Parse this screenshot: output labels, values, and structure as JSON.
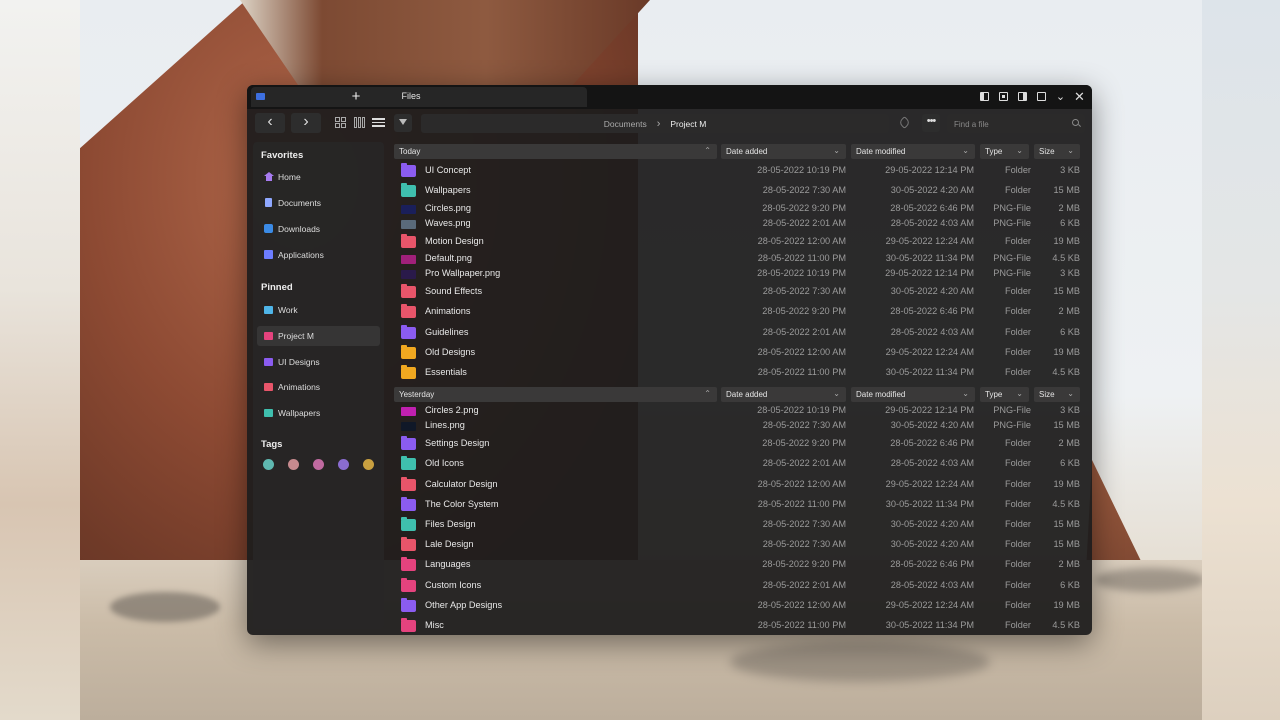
{
  "window": {
    "title": "Files",
    "new_tab": "+"
  },
  "titlebar_buttons": [
    "panel-left-icon",
    "panel-center-icon",
    "panel-right-icon",
    "restore-icon",
    "chevron-down-icon",
    "close-icon"
  ],
  "toolbar": {
    "back": "‹",
    "forward": "›",
    "breadcrumb": [
      "Documents",
      "Project M"
    ],
    "more": "•••",
    "search_placeholder": "Find a file"
  },
  "sidebar": {
    "favorites_heading": "Favorites",
    "favorites": [
      {
        "label": "Home",
        "icon": "home-icon"
      },
      {
        "label": "Documents",
        "icon": "document-icon"
      },
      {
        "label": "Downloads",
        "icon": "download-icon"
      },
      {
        "label": "Applications",
        "icon": "applications-icon"
      }
    ],
    "pinned_heading": "Pinned",
    "pinned": [
      {
        "label": "Work",
        "color": "#4fb5e8"
      },
      {
        "label": "Project M",
        "color": "#e5437e",
        "active": true
      },
      {
        "label": "UI Designs",
        "color": "#8b5cf0"
      },
      {
        "label": "Animations",
        "color": "#e8556a"
      },
      {
        "label": "Wallpapers",
        "color": "#3fbfae"
      }
    ],
    "tags_heading": "Tags",
    "tags": [
      "#5fb8b0",
      "#c78a8e",
      "#c06aa0",
      "#8a6cd0",
      "#c9a040"
    ]
  },
  "columns": {
    "name_today": "Today",
    "name_yesterday": "Yesterday",
    "date_added": "Date added",
    "date_modified": "Date modified",
    "type": "Type",
    "size": "Size"
  },
  "groups": [
    {
      "rows": [
        {
          "name": "UI Concept",
          "added": "28-05-2022 10:19 PM",
          "modified": "29-05-2022 12:14 PM",
          "type": "Folder",
          "size": "3 KB",
          "color": "#8b5cf0",
          "kind": "folder"
        },
        {
          "name": "Wallpapers",
          "added": "28-05-2022 7:30 AM",
          "modified": "30-05-2022 4:20 AM",
          "type": "Folder",
          "size": "15 MB",
          "color": "#3fbfae",
          "kind": "folder"
        },
        {
          "name": "Circles.png",
          "added": "28-05-2022 9:20 PM",
          "modified": "28-05-2022 6:46 PM",
          "type": "PNG-File",
          "size": "2 MB",
          "color": "#1a1f5a",
          "kind": "png"
        },
        {
          "name": "Waves.png",
          "added": "28-05-2022 2:01 AM",
          "modified": "28-05-2022 4:03 AM",
          "type": "PNG-File",
          "size": "6 KB",
          "color": "#5a6a7a",
          "kind": "png"
        },
        {
          "name": "Motion Design",
          "added": "28-05-2022 12:00 AM",
          "modified": "29-05-2022 12:24 AM",
          "type": "Folder",
          "size": "19 MB",
          "color": "#e8556a",
          "kind": "folder"
        },
        {
          "name": "Default.png",
          "added": "28-05-2022 11:00 PM",
          "modified": "30-05-2022 11:34 PM",
          "type": "PNG-File",
          "size": "4.5 KB",
          "color": "#a0207a",
          "kind": "png"
        },
        {
          "name": "Pro Wallpaper.png",
          "added": "28-05-2022 10:19 PM",
          "modified": "29-05-2022 12:14 PM",
          "type": "PNG-File",
          "size": "3 KB",
          "color": "#2a1a4a",
          "kind": "png"
        },
        {
          "name": "Sound Effects",
          "added": "28-05-2022 7:30 AM",
          "modified": "30-05-2022 4:20 AM",
          "type": "Folder",
          "size": "15 MB",
          "color": "#e8556a",
          "kind": "folder"
        },
        {
          "name": "Animations",
          "added": "28-05-2022 9:20 PM",
          "modified": "28-05-2022 6:46 PM",
          "type": "Folder",
          "size": "2 MB",
          "color": "#e8556a",
          "kind": "folder"
        },
        {
          "name": "Guidelines",
          "added": "28-05-2022 2:01 AM",
          "modified": "28-05-2022 4:03 AM",
          "type": "Folder",
          "size": "6 KB",
          "color": "#8b5cf0",
          "kind": "folder"
        },
        {
          "name": "Old Designs",
          "added": "28-05-2022 12:00 AM",
          "modified": "29-05-2022 12:24 AM",
          "type": "Folder",
          "size": "19 MB",
          "color": "#f0a820",
          "kind": "folder"
        },
        {
          "name": "Essentials",
          "added": "28-05-2022 11:00 PM",
          "modified": "30-05-2022 11:34 PM",
          "type": "Folder",
          "size": "4.5 KB",
          "color": "#f0a820",
          "kind": "folder"
        }
      ]
    },
    {
      "rows": [
        {
          "name": "Circles 2.png",
          "added": "28-05-2022 10:19 PM",
          "modified": "29-05-2022 12:14 PM",
          "type": "PNG-File",
          "size": "3 KB",
          "color": "#c020b0",
          "kind": "png"
        },
        {
          "name": "Lines.png",
          "added": "28-05-2022 7:30 AM",
          "modified": "30-05-2022 4:20 AM",
          "type": "PNG-File",
          "size": "15 MB",
          "color": "#101828",
          "kind": "png"
        },
        {
          "name": "Settings Design",
          "added": "28-05-2022 9:20 PM",
          "modified": "28-05-2022 6:46 PM",
          "type": "Folder",
          "size": "2 MB",
          "color": "#8b5cf0",
          "kind": "folder"
        },
        {
          "name": "Old Icons",
          "added": "28-05-2022 2:01 AM",
          "modified": "28-05-2022 4:03 AM",
          "type": "Folder",
          "size": "6 KB",
          "color": "#3fbfae",
          "kind": "folder"
        },
        {
          "name": "Calculator Design",
          "added": "28-05-2022 12:00 AM",
          "modified": "29-05-2022 12:24 AM",
          "type": "Folder",
          "size": "19 MB",
          "color": "#e8556a",
          "kind": "folder"
        },
        {
          "name": "The Color System",
          "added": "28-05-2022 11:00 PM",
          "modified": "30-05-2022 11:34 PM",
          "type": "Folder",
          "size": "4.5 KB",
          "color": "#8b5cf0",
          "kind": "folder"
        },
        {
          "name": "Files Design",
          "added": "28-05-2022 7:30 AM",
          "modified": "30-05-2022 4:20 AM",
          "type": "Folder",
          "size": "15 MB",
          "color": "#3fbfae",
          "kind": "folder"
        },
        {
          "name": "Lale Design",
          "added": "28-05-2022 7:30 AM",
          "modified": "30-05-2022 4:20 AM",
          "type": "Folder",
          "size": "15 MB",
          "color": "#e8556a",
          "kind": "folder"
        },
        {
          "name": "Languages",
          "added": "28-05-2022 9:20 PM",
          "modified": "28-05-2022 6:46 PM",
          "type": "Folder",
          "size": "2 MB",
          "color": "#e5437e",
          "kind": "folder"
        },
        {
          "name": "Custom Icons",
          "added": "28-05-2022 2:01 AM",
          "modified": "28-05-2022 4:03 AM",
          "type": "Folder",
          "size": "6 KB",
          "color": "#e5437e",
          "kind": "folder"
        },
        {
          "name": "Other App Designs",
          "added": "28-05-2022 12:00 AM",
          "modified": "29-05-2022 12:24 AM",
          "type": "Folder",
          "size": "19 MB",
          "color": "#8b5cf0",
          "kind": "folder"
        },
        {
          "name": "Misc",
          "added": "28-05-2022 11:00 PM",
          "modified": "30-05-2022 11:34 PM",
          "type": "Folder",
          "size": "4.5 KB",
          "color": "#e5437e",
          "kind": "folder"
        }
      ]
    }
  ]
}
